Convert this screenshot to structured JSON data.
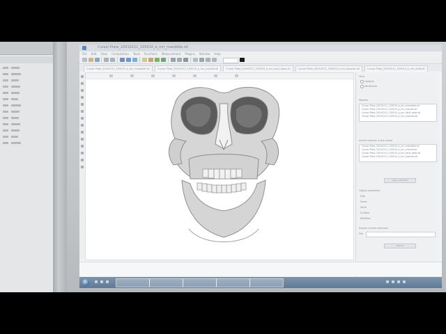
{
  "window": {
    "title": "Cursor Plate_20010211_105010_e_mri_mandible.stl"
  },
  "menubar": {
    "items": [
      "File",
      "Edit",
      "View",
      "Composition",
      "Tools",
      "Functions",
      "Measurement",
      "Plugins",
      "Window",
      "Help"
    ]
  },
  "toolbar": {
    "field_value": "",
    "text": ""
  },
  "file_tabs": [
    "Cursor Plate_20010211_105010_e_mri_mandible.stl",
    "Cursor Plate_20010211_105010_e_mri_maxilla.stl",
    "Cursor Plate_20010211_105010_e_mri_skull_base.stl",
    "Cursor Plate_20010211_105010_e_mri_ossicles.stl",
    "Cursor Plate_20010211_105010_e_mri_orbit.stl"
  ],
  "right_panel": {
    "view_label": "View",
    "radio_1": "Opaque",
    "radio_2": "Wireframe",
    "mesh_list_label": "Meshes",
    "mesh_list": [
      "Cursor Plate_20010211_105010_e_mri_mandible.stl",
      "Cursor Plate_20010211_105010_e_mri_maxilla.stl",
      "Cursor Plate_20010211_105010_e_mri_skull_base.stl",
      "Cursor Plate_20010211_105010_e_mri_ossicles.stl"
    ],
    "selected_label": "Active meshes in the scene",
    "selected_list": [
      "Cursor Plate_20010211_105010_e_mri_mandible.stl",
      "Cursor Plate_20010211_105010_e_mri_maxilla.stl",
      "Cursor Plate_20010211_105010_e_mri_skull_base.stl",
      "Cursor Plate_20010211_105010_e_mri_ossicles.stl"
    ],
    "apply_button": "Apply selection",
    "props_label": "Object properties",
    "props": [
      "Size",
      "Faces",
      "Verts",
      "Surface",
      "Min/Max"
    ],
    "export_label": "Export current selection",
    "file_label": "File",
    "export_button": "Export"
  },
  "taskbar": {
    "apps": [
      "",
      "",
      "",
      "",
      ""
    ]
  }
}
